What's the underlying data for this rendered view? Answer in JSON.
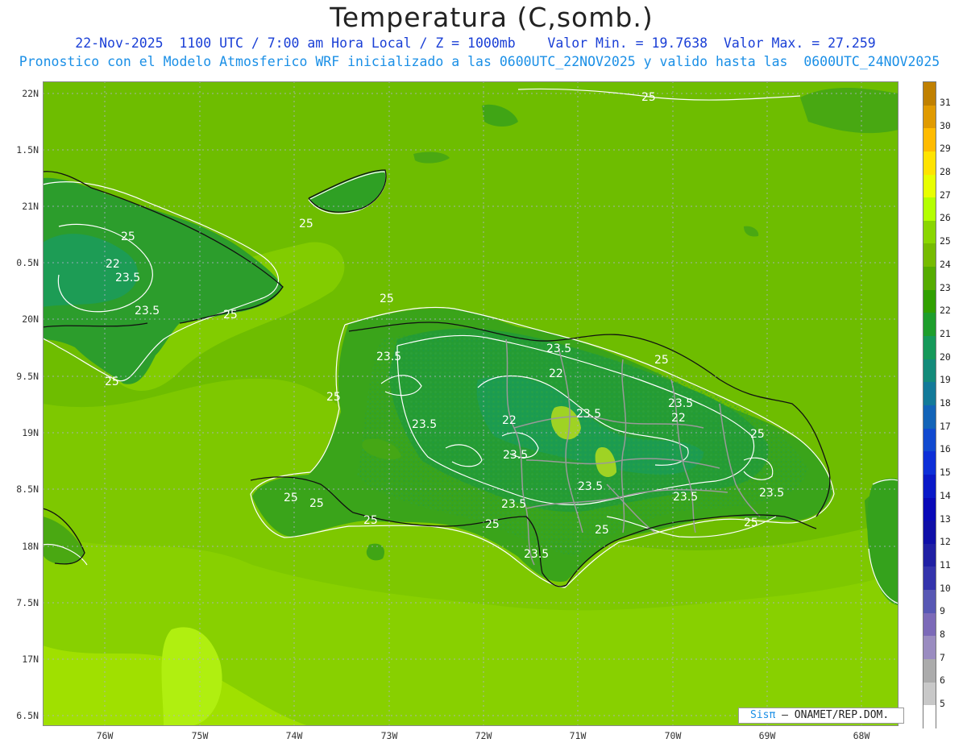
{
  "title": "Temperatura (C,somb.)",
  "subtitle_line1": "22-Nov-2025  1100 UTC / 7:00 am Hora Local / Z = 1000mb    Valor Min. = 19.7638  Valor Max. = 27.259",
  "subtitle_line2": "Pronostico con el Modelo Atmosferico WRF inicializado a las 0600UTC_22NOV2025 y valido hasta las  0600UTC_24NOV2025",
  "lat_labels": [
    "22N",
    "1.5N",
    "21N",
    "0.5N",
    "20N",
    "9.5N",
    "19N",
    "8.5N",
    "18N",
    "7.5N",
    "17N",
    "6.5N"
  ],
  "lon_labels": [
    "76W",
    "75W",
    "74W",
    "73W",
    "72W",
    "71W",
    "70W",
    "69W",
    "68W"
  ],
  "colorbar": {
    "labels": [
      "31",
      "30",
      "29",
      "28",
      "27",
      "26",
      "25",
      "24",
      "23",
      "22",
      "21",
      "20",
      "19",
      "18",
      "17",
      "16",
      "15",
      "14",
      "13",
      "12",
      "11",
      "10",
      "9",
      "8",
      "7",
      "6",
      "5"
    ],
    "colors": [
      "#c08000",
      "#e09a00",
      "#ffbb00",
      "#ffe300",
      "#e8ff00",
      "#b4ff00",
      "#8ad600",
      "#76bb00",
      "#56ac00",
      "#31a000",
      "#1e9e2c",
      "#16995a",
      "#148b7a",
      "#137a99",
      "#1364b8",
      "#114ad0",
      "#0d2fd8",
      "#0a19c8",
      "#0a0ab8",
      "#1010a8",
      "#2020a4",
      "#3434ac",
      "#5858b4",
      "#7c6ab8",
      "#9a8cc0",
      "#ababab",
      "#c8c8c8",
      "#ffffff"
    ]
  },
  "contour_labels": [
    "25",
    "25",
    "25",
    "22",
    "23.5",
    "23.5",
    "25",
    "25",
    "25",
    "23.5",
    "25",
    "23.5",
    "22",
    "25",
    "23.5",
    "22",
    "23.5",
    "22",
    "23.5",
    "25",
    "23.5",
    "25",
    "25",
    "23.5",
    "23.5",
    "23.5",
    "25",
    "23.5",
    "25",
    "25",
    "23.5",
    "25"
  ],
  "field_colors": {
    "sea_cool": "#82cc00",
    "sea_mid": "#6ebd00",
    "sea_warm": "#a8e800",
    "land_low": "#43a511",
    "land_mid": "#289d2e",
    "land_high": "#1e9c52",
    "hot_spot": "#a0d420"
  },
  "credit": {
    "brand": "Sisπ",
    "text": "– ONAMET/REP.DOM."
  }
}
